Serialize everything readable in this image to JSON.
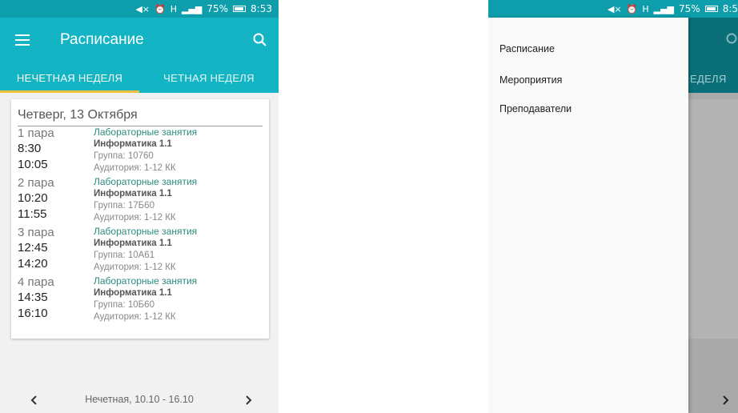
{
  "status_bar": {
    "battery": "75%",
    "time": "8:53",
    "time_partial": "8:5",
    "signal_label": "H"
  },
  "app_bar": {
    "title": "Расписание",
    "menu_icon": "hamburger-icon",
    "search_icon": "search-icon"
  },
  "tabs": [
    {
      "label": "НЕЧЕТНАЯ НЕДЕЛЯ",
      "active": true
    },
    {
      "label": "ЧЕТНАЯ НЕДЕЛЯ",
      "active": false
    }
  ],
  "day": {
    "title": "Четверг, 13 Октября",
    "lessons": [
      {
        "pair": "1 пара",
        "start": "8:30",
        "end": "10:05",
        "type": "Лабораторные занятия",
        "subject": "Информатика 1.1",
        "group": "Группа: 10760",
        "room": "Аудитория: 1-12 КК"
      },
      {
        "pair": "2 пара",
        "start": "10:20",
        "end": "11:55",
        "type": "Лабораторные занятия",
        "subject": "Информатика 1.1",
        "group": "Группа: 17Б60",
        "room": "Аудитория: 1-12 КК"
      },
      {
        "pair": "3 пара",
        "start": "12:45",
        "end": "14:20",
        "type": "Лабораторные занятия",
        "subject": "Информатика 1.1",
        "group": "Группа: 10А61",
        "room": "Аудитория: 1-12 КК"
      },
      {
        "pair": "4 пара",
        "start": "14:35",
        "end": "16:10",
        "type": "Лабораторные занятия",
        "subject": "Информатика 1.1",
        "group": "Группа: 10Б60",
        "room": "Аудитория: 1-12 КК"
      }
    ]
  },
  "bottom_bar": {
    "range": "Нечетная, 10.10 - 16.10",
    "prev_icon": "chevron-left-icon",
    "next_icon": "chevron-right-icon"
  },
  "drawer": {
    "items": [
      {
        "label": "Расписание"
      },
      {
        "label": "Мероприятия"
      },
      {
        "label": "Преподаватели"
      }
    ],
    "background_tab_fragment": "ЕДЕЛЯ"
  },
  "colors": {
    "primary": "#13b4c4",
    "status_bar": "#0e9eab",
    "tab_indicator": "#f0c23a",
    "lesson_type": "#2a8c7e"
  }
}
